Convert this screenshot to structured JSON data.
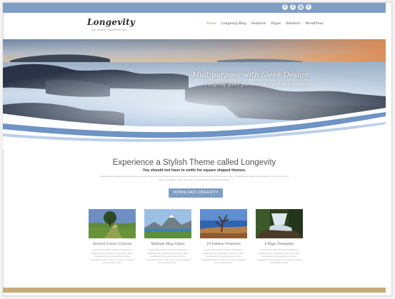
{
  "header": {
    "logo_title": "Longevity",
    "logo_tagline": "Just another WordPress site",
    "social_icons": [
      "twitter-icon",
      "facebook-icon",
      "google-plus-icon",
      "rss-icon"
    ],
    "social_glyphs": [
      "t",
      "f",
      "g",
      "r"
    ],
    "nav": [
      "Home",
      "Longevity Blog",
      "Features",
      "Pages",
      "Sidebars",
      "WordPress"
    ],
    "active_nav": "Home"
  },
  "hero": {
    "title": "Multipurpose with Sleek Design",
    "subtitle": "Longevity gives you several styles and features"
  },
  "intro": {
    "heading": "Experience a Stylish Theme called Longevity",
    "subheading": "You should not have to settle for square shaped themes.",
    "body": "Clean simple design with with a variety of colour options, several blog styles and layouts, animation, plus much more! The theme is uses a multipurpose design which means you can use it for a variety of websites, from corporate to e-commerce to professional artists.",
    "button_label": "DOWNLOAD LONGEVITY"
  },
  "features": [
    {
      "title": "Several Colour Choices",
      "text": "Lorem ipsum dolor sit amet, consectetur adipiscing elit. Vestibulum nec lorem urna. Vestibulum fermentum libero at ante consectetur dictum vitae nec mauris. Vivamus id erat vitae lectus."
    },
    {
      "title": "Multiple Blog Styles",
      "text": "Lorem ipsum dolor sit amet, consectetur adipiscing elit. Vestibulum nec lorem urna. Vestibulum fermentum libero at ante consectetur dictum vitae nec mauris. Vivamus id erat vitae lectus."
    },
    {
      "title": "19 Sidebar Positions",
      "text": "Lorem ipsum dolor sit amet, consectetur adipiscing elit. Vestibulum nec lorem urna. Vestibulum fermentum libero at ante consectetur dictum vitae nec mauris. Vivamus id erat vitae lectus."
    },
    {
      "title": "6 Page Templates",
      "text": "Lorem ipsum dolor sit amet, consectetur adipiscing elit. Vestibulum nec lorem urna. Vestibulum fermentum libero at ante consectetur dictum vitae nec mauris. Vivamus id erat vitae lectus."
    }
  ],
  "colors": {
    "accent_blue": "#7f9ec6",
    "footer_gold": "#c8a979",
    "active_nav": "#c0795a"
  }
}
